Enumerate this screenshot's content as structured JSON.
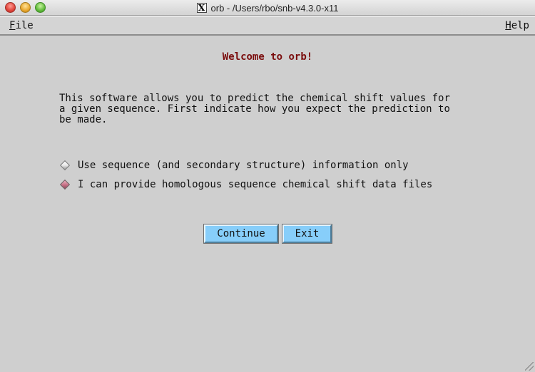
{
  "window": {
    "title": "orb - /Users/rbo/snb-v4.3.0-x11",
    "app_icon": "x11-icon"
  },
  "menubar": {
    "file": {
      "mnemonic": "F",
      "rest": "ile"
    },
    "help": {
      "mnemonic": "H",
      "rest": "elp"
    }
  },
  "content": {
    "welcome": "Welcome to orb!",
    "description": "This software allows you to predict the chemical shift values for\na given sequence. First indicate how you expect the prediction to\nbe made.",
    "options": [
      {
        "label": "Use sequence (and secondary structure) information only",
        "selected": false
      },
      {
        "label": "I can provide homologous sequence chemical shift data files",
        "selected": true
      }
    ]
  },
  "buttons": {
    "continue": "Continue",
    "exit": "Exit"
  },
  "colors": {
    "background": "#cfcfcf",
    "welcome_text": "#7a0c0c",
    "button": "#87cefa",
    "radio_selected": "#c06a80"
  }
}
